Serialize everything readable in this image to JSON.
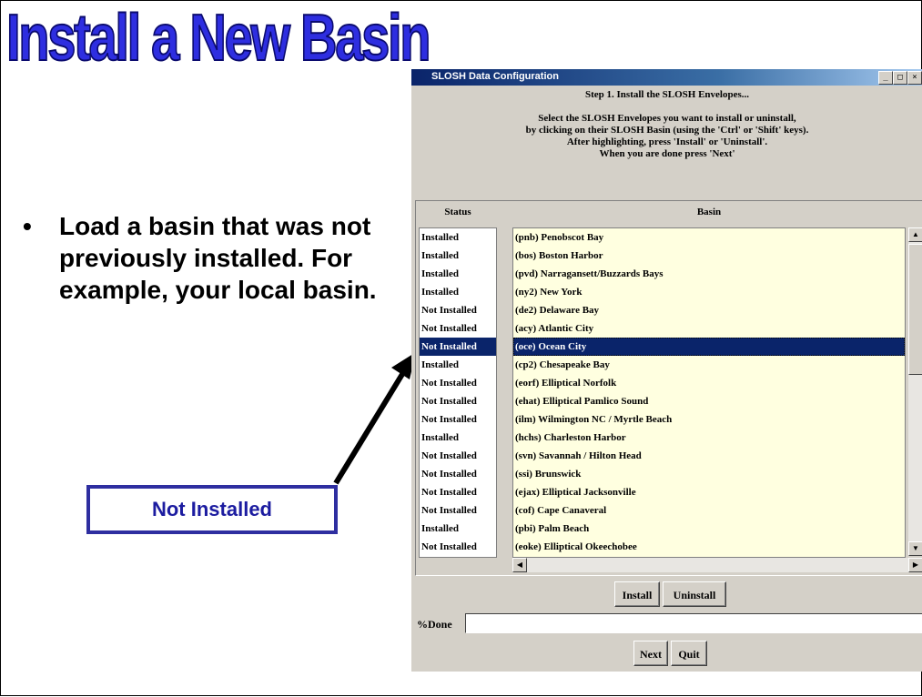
{
  "slide": {
    "title": "Install a New Basin",
    "bullet": "Load a basin that was not previously installed. For example, your local basin.",
    "callout": "Not Installed"
  },
  "window": {
    "title": "SLOSH Data Configuration",
    "controls": {
      "minimize": "_",
      "maximize": "□",
      "close": "×"
    },
    "instructions": {
      "step": "Step 1. Install the SLOSH Envelopes...",
      "line1": "Select the SLOSH Envelopes you want to install or uninstall,",
      "line2": "by clicking on their SLOSH Basin (using the 'Ctrl' or 'Shift' keys).",
      "line3": "After highlighting, press 'Install' or 'Uninstall'.",
      "line4": "When you are done press 'Next'"
    },
    "columns": {
      "status": "Status",
      "basin": "Basin"
    },
    "rows": [
      {
        "status": "Installed",
        "basin": "(pnb) Penobscot Bay"
      },
      {
        "status": "Installed",
        "basin": "(bos) Boston Harbor"
      },
      {
        "status": "Installed",
        "basin": "(pvd) Narragansett/Buzzards Bays"
      },
      {
        "status": "Installed",
        "basin": "(ny2) New York"
      },
      {
        "status": "Not Installed",
        "basin": "(de2) Delaware Bay"
      },
      {
        "status": "Not Installed",
        "basin": "(acy) Atlantic City"
      },
      {
        "status": "Not Installed",
        "basin": "(oce) Ocean City"
      },
      {
        "status": "Installed",
        "basin": "(cp2) Chesapeake Bay"
      },
      {
        "status": "Not Installed",
        "basin": "(eorf) Elliptical Norfolk"
      },
      {
        "status": "Not Installed",
        "basin": "(ehat) Elliptical Pamlico Sound"
      },
      {
        "status": "Not Installed",
        "basin": "(ilm) Wilmington NC / Myrtle Beach"
      },
      {
        "status": "Installed",
        "basin": "(hchs) Charleston Harbor"
      },
      {
        "status": "Not Installed",
        "basin": "(svn) Savannah / Hilton Head"
      },
      {
        "status": "Not Installed",
        "basin": "(ssi) Brunswick"
      },
      {
        "status": "Not Installed",
        "basin": "(ejax) Elliptical Jacksonville"
      },
      {
        "status": "Not Installed",
        "basin": "(cof) Cape Canaveral"
      },
      {
        "status": "Installed",
        "basin": "(pbi) Palm Beach"
      },
      {
        "status": "Not Installed",
        "basin": "(eoke) Elliptical Okeechobee"
      }
    ],
    "selected_row": 6,
    "buttons": {
      "install": "Install",
      "uninstall": "Uninstall",
      "next": "Next",
      "quit": "Quit"
    },
    "progress": {
      "label": "%Done",
      "value": ""
    },
    "colors": {
      "selection": "#0a246a",
      "basin_bg": "#ffffe0",
      "title_accent": "#2e2ee0"
    }
  }
}
